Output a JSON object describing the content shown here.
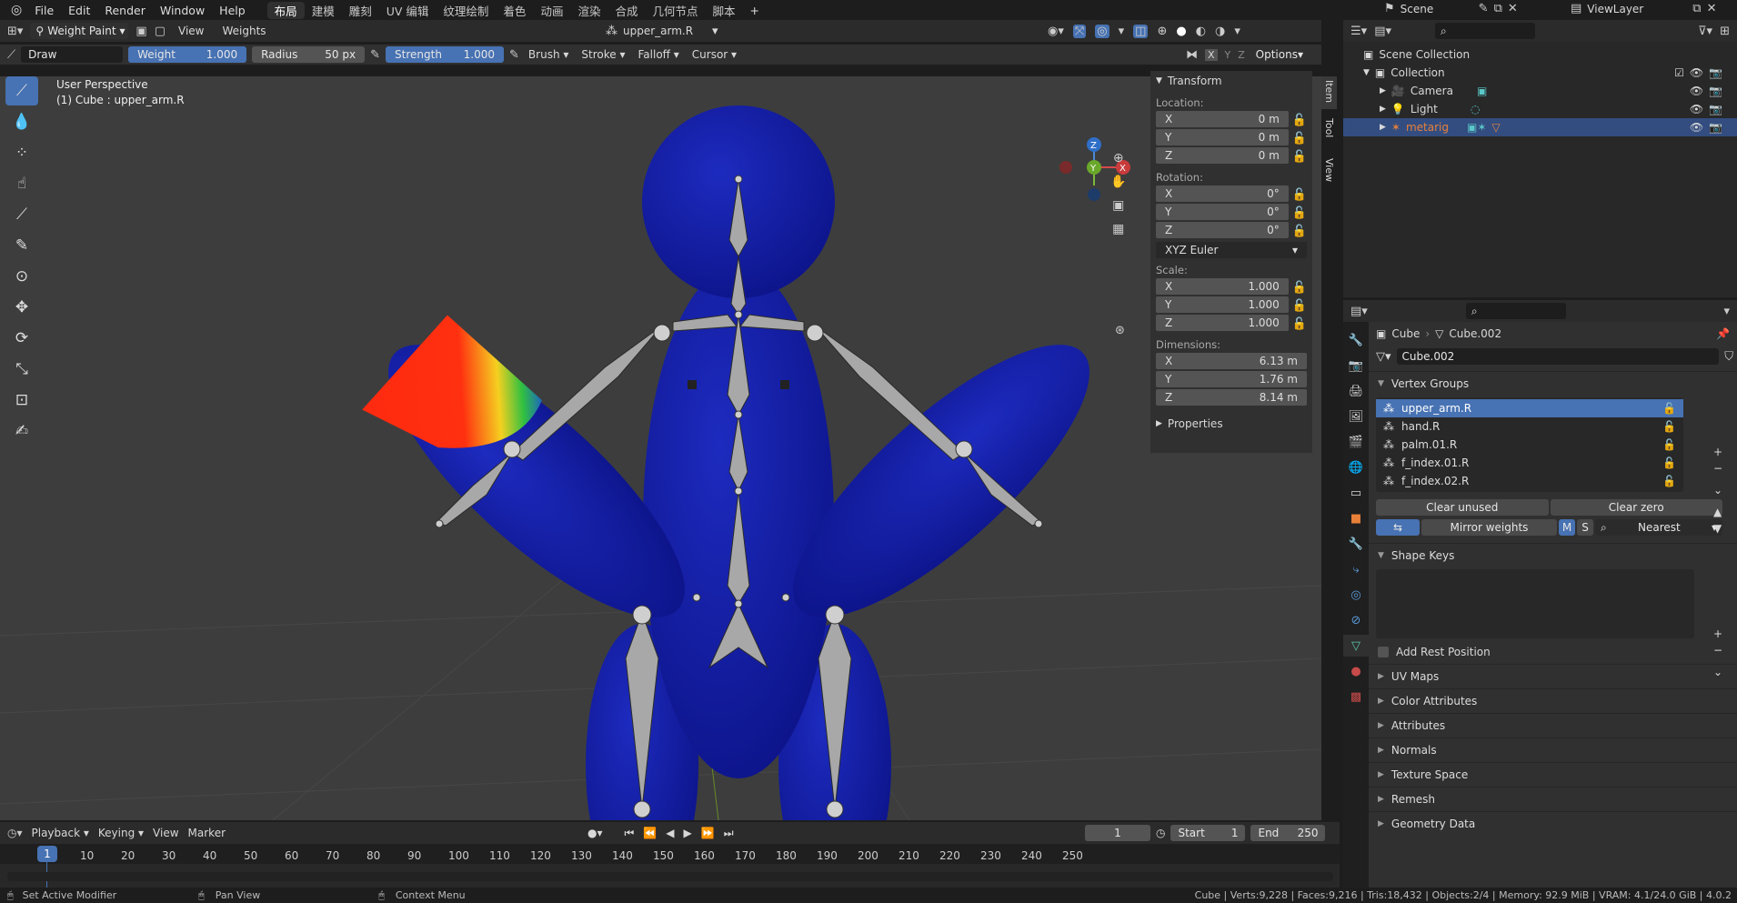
{
  "menu": {
    "items": [
      "File",
      "Edit",
      "Render",
      "Window",
      "Help"
    ],
    "workspaces": [
      "布局",
      "建模",
      "雕刻",
      "UV 编辑",
      "纹理绘制",
      "着色",
      "动画",
      "渲染",
      "合成",
      "几何节点",
      "脚本"
    ],
    "scene": "Scene",
    "view_layer": "ViewLayer"
  },
  "header": {
    "mode": "Weight Paint",
    "view": "View",
    "weights": "Weights",
    "object_name": "upper_arm.R"
  },
  "toolheader": {
    "brush_name": "Draw",
    "weight_label": "Weight",
    "weight_value": "1.000",
    "radius_label": "Radius",
    "radius_value": "50 px",
    "strength_label": "Strength",
    "strength_value": "1.000",
    "brush": "Brush",
    "stroke": "Stroke",
    "falloff": "Falloff",
    "cursor": "Cursor",
    "x": "X",
    "y": "Y",
    "z": "Z",
    "options": "Options"
  },
  "viewport": {
    "perspective": "User Perspective",
    "object_info": "(1) Cube : upper_arm.R",
    "gizmo": {
      "x": "X",
      "y": "Y",
      "z": "Z"
    }
  },
  "npanel": {
    "tabs": [
      "Item",
      "Tool",
      "View"
    ],
    "transform": "Transform",
    "location_label": "Location:",
    "location": [
      "0 m",
      "0 m",
      "0 m"
    ],
    "rotation_label": "Rotation:",
    "rotation": [
      "0°",
      "0°",
      "0°"
    ],
    "rotation_mode": "XYZ Euler",
    "scale_label": "Scale:",
    "scale": [
      "1.000",
      "1.000",
      "1.000"
    ],
    "dimensions_label": "Dimensions:",
    "dimensions": [
      "6.13 m",
      "1.76 m",
      "8.14 m"
    ],
    "axes": [
      "X",
      "Y",
      "Z"
    ],
    "properties": "Properties"
  },
  "outliner": {
    "scene_collection": "Scene Collection",
    "collection": "Collection",
    "items": [
      "Camera",
      "Light",
      "metarig"
    ]
  },
  "properties": {
    "breadcrumb_object": "Cube",
    "breadcrumb_mesh": "Cube.002",
    "mesh_name": "Cube.002",
    "vertex_groups_title": "Vertex Groups",
    "vertex_groups": [
      "upper_arm.R",
      "hand.R",
      "palm.01.R",
      "f_index.01.R",
      "f_index.02.R"
    ],
    "clear_unused": "Clear unused",
    "clear_zero": "Clear zero",
    "mirror_weights": "Mirror weights",
    "m": "M",
    "s": "S",
    "nearest": "Nearest",
    "shape_keys_title": "Shape Keys",
    "add_rest_position": "Add Rest Position",
    "sections": [
      "UV Maps",
      "Color Attributes",
      "Attributes",
      "Normals",
      "Texture Space",
      "Remesh",
      "Geometry Data"
    ]
  },
  "timeline": {
    "playback": "Playback",
    "keying": "Keying",
    "view": "View",
    "marker": "Marker",
    "current_frame": "1",
    "start_label": "Start",
    "start": "1",
    "end_label": "End",
    "end": "250",
    "ticks": [
      "1",
      "10",
      "20",
      "30",
      "40",
      "50",
      "60",
      "70",
      "80",
      "90",
      "100",
      "110",
      "120",
      "130",
      "140",
      "150",
      "160",
      "170",
      "180",
      "190",
      "200",
      "210",
      "220",
      "230",
      "240",
      "250"
    ]
  },
  "statusbar": {
    "left1": "Set Active Modifier",
    "left2": "Pan View",
    "left3": "Context Menu",
    "stats": "Cube | Verts:9,228 | Faces:9,216 | Tris:18,432 | Objects:2/4 | Memory: 92.9 MiB | VRAM: 4.1/24.0 GiB | 4.0.2"
  },
  "colors": {
    "accent": "#4772b3",
    "mesh": "#141ea0",
    "viewport_bg": "#3d3d3d",
    "orange": "#e8803a"
  }
}
